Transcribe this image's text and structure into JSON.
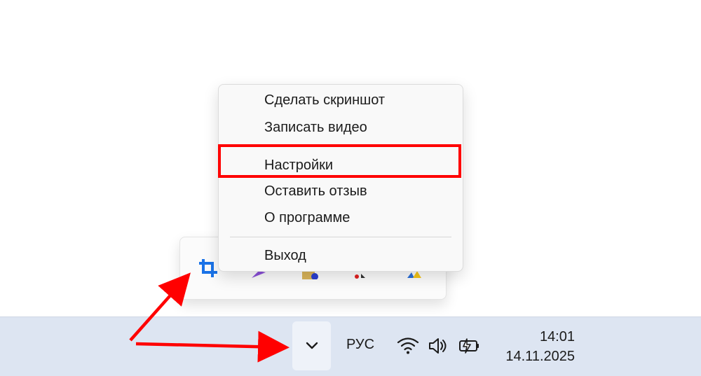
{
  "context_menu": {
    "items": [
      {
        "label": "Сделать скриншот"
      },
      {
        "label": "Записать видео"
      },
      {
        "label": "Настройки"
      },
      {
        "label": "Оставить отзыв"
      },
      {
        "label": "О программе"
      },
      {
        "label": "Выход"
      }
    ],
    "highlighted_item": "Настройки"
  },
  "tray_flyout": {
    "icons": [
      "crop-capture-icon",
      "purple-app-icon",
      "folder-app-icon",
      "red-app-icon",
      "warning-app-icon"
    ]
  },
  "taskbar": {
    "overflow_button_icon": "chevron-down-icon",
    "language": "РУС",
    "wifi_icon": "wifi-icon",
    "volume_icon": "volume-icon",
    "battery_icon": "battery-charging-icon",
    "clock": {
      "time": "14:01",
      "date": "14.11.2025"
    }
  },
  "annotation": {
    "color": "#ff0000"
  },
  "colors": {
    "taskbar_bg": "#dde5f2",
    "accent": "#1a73e8"
  }
}
